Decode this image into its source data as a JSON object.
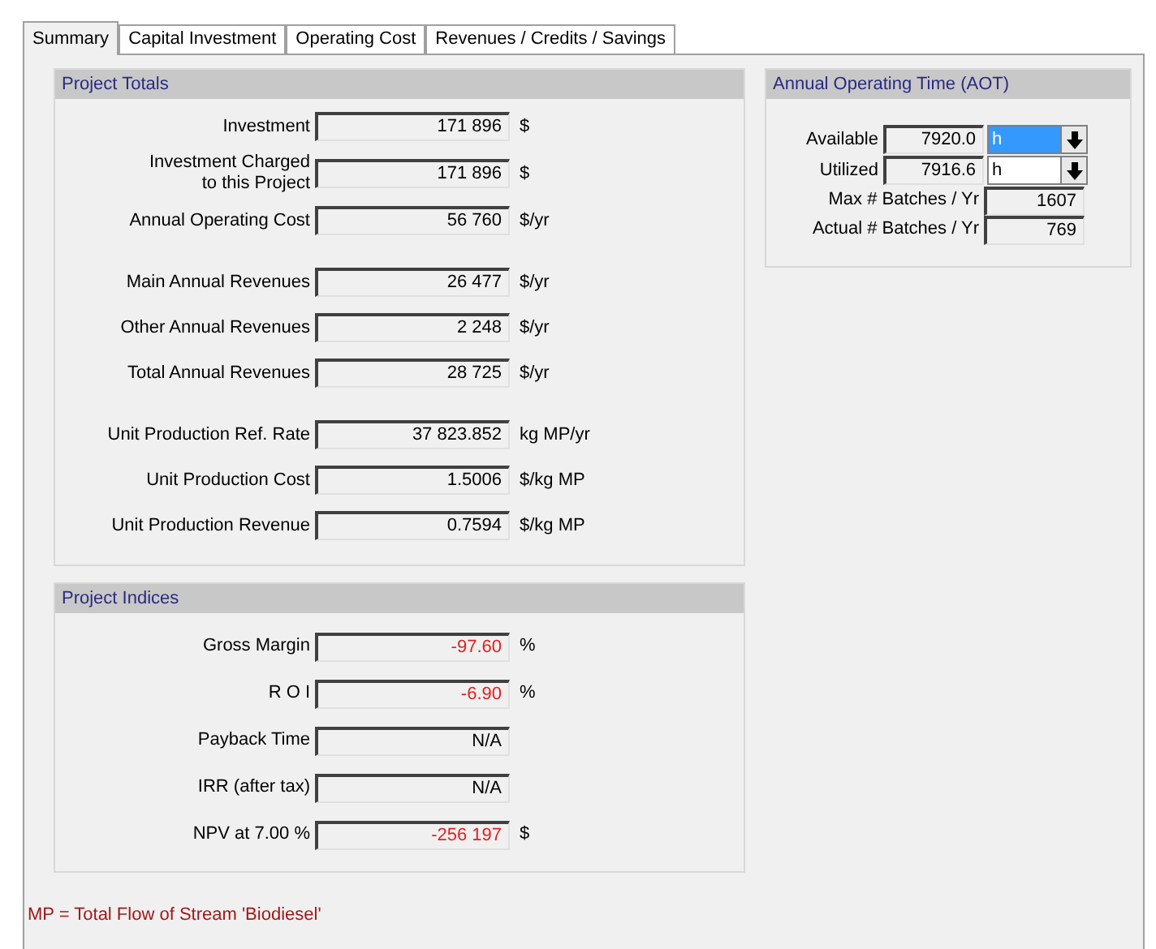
{
  "tabs": [
    {
      "label": "Summary",
      "selected": true
    },
    {
      "label": "Capital Investment",
      "selected": false
    },
    {
      "label": "Operating Cost",
      "selected": false
    },
    {
      "label": "Revenues / Credits / Savings",
      "selected": false
    }
  ],
  "project_totals": {
    "title": "Project Totals",
    "groups": [
      [
        {
          "label": "Investment",
          "value": "171 896",
          "unit": "$"
        },
        {
          "label": "Investment Charged\nto this Project",
          "value": "171 896",
          "unit": "$"
        },
        {
          "label": "Annual Operating Cost",
          "value": "56 760",
          "unit": "$/yr"
        }
      ],
      [
        {
          "label": "Main Annual Revenues",
          "value": "26 477",
          "unit": "$/yr"
        },
        {
          "label": "Other Annual Revenues",
          "value": "2 248",
          "unit": "$/yr"
        },
        {
          "label": "Total Annual Revenues",
          "value": "28 725",
          "unit": "$/yr"
        }
      ],
      [
        {
          "label": "Unit Production Ref. Rate",
          "value": "37 823.852",
          "unit": "kg MP/yr"
        },
        {
          "label": "Unit Production Cost",
          "value": "1.5006",
          "unit": "$/kg MP"
        },
        {
          "label": "Unit Production Revenue",
          "value": "0.7594",
          "unit": "$/kg MP"
        }
      ]
    ]
  },
  "project_indices": {
    "title": "Project Indices",
    "rows": [
      {
        "label": "Gross Margin",
        "value": "-97.60",
        "unit": "%",
        "negative": true
      },
      {
        "label": "R O I",
        "value": "-6.90",
        "unit": "%",
        "negative": true
      },
      {
        "label": "Payback Time",
        "value": "N/A",
        "negative": false
      },
      {
        "label": "IRR (after tax)",
        "value": "N/A",
        "negative": false
      },
      {
        "label": "NPV at 7.00  %",
        "value": "-256 197",
        "unit": "$",
        "negative": true
      }
    ]
  },
  "annual_operating_time": {
    "title": "Annual Operating Time (AOT)",
    "rows": [
      {
        "kind": "unit",
        "label": "Available",
        "value": "7920.0",
        "unit": "h",
        "highlighted": true
      },
      {
        "kind": "unit",
        "label": "Utilized",
        "value": "7916.6",
        "unit": "h",
        "highlighted": false
      },
      {
        "kind": "plain",
        "label": "Max # Batches / Yr",
        "value": "1607"
      },
      {
        "kind": "plain",
        "label": "Actual # Batches / Yr",
        "value": "769"
      }
    ]
  },
  "footnote": "MP = Total Flow of Stream 'Biodiesel'"
}
